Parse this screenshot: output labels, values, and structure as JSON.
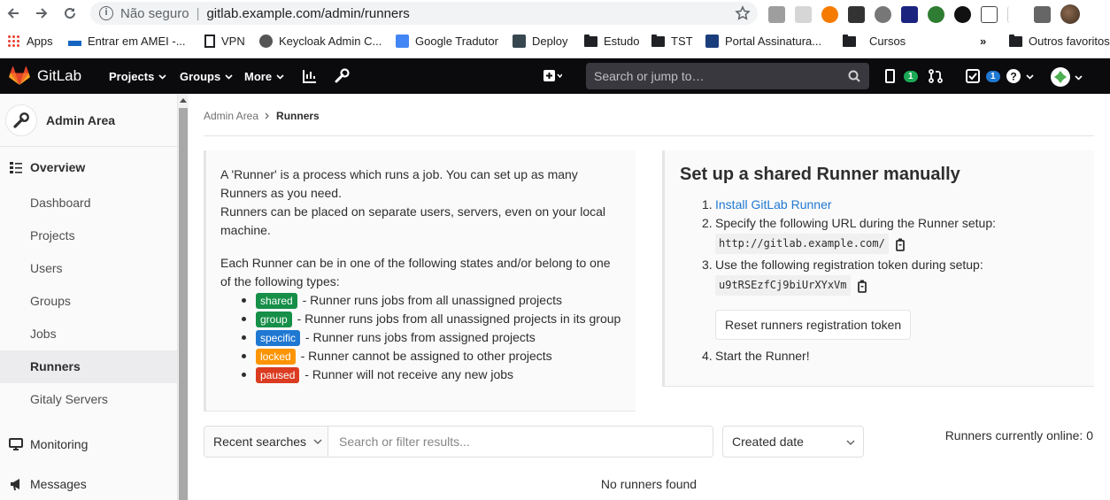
{
  "browser": {
    "insecure_label": "Não seguro",
    "url": "gitlab.example.com/admin/runners",
    "bookmarks": [
      "Apps",
      "Entrar em AMEI -...",
      "VPN",
      "Keycloak Admin C...",
      "Google Tradutor",
      "Deploy",
      "Estudo",
      "TST",
      "Portal Assinatura...",
      "Cursos",
      "»",
      "Outros favoritos"
    ]
  },
  "header": {
    "brand": "GitLab",
    "projects": "Projects",
    "groups": "Groups",
    "more": "More",
    "search_placeholder": "Search or jump to…",
    "issues_count": "1",
    "todos_count": "1"
  },
  "sidebar": {
    "title": "Admin Area",
    "overview": "Overview",
    "items": [
      "Dashboard",
      "Projects",
      "Users",
      "Groups",
      "Jobs",
      "Runners",
      "Gitaly Servers"
    ],
    "monitoring": "Monitoring",
    "messages": "Messages"
  },
  "breadcrumb": {
    "parent": "Admin Area",
    "current": "Runners"
  },
  "info": {
    "p1_line1": "A 'Runner' is a process which runs a job. You can set up as many",
    "p1_line2": "Runners as you need.",
    "p1_line3": "Runners can be placed on separate users, servers, even on your local",
    "p1_line4": "machine.",
    "p2_line1": "Each Runner can be in one of the following states and/or belong to one",
    "p2_line2": "of the following types:",
    "types": [
      {
        "tag": "shared",
        "desc": "- Runner runs jobs from all unassigned projects",
        "color": "#168f48"
      },
      {
        "tag": "group",
        "desc": "- Runner runs jobs from all unassigned projects in its group",
        "color": "#168f48"
      },
      {
        "tag": "specific",
        "desc": "- Runner runs jobs from assigned projects",
        "color": "#1f78d1"
      },
      {
        "tag": "locked",
        "desc": "- Runner cannot be assigned to other projects",
        "color": "#fc9403"
      },
      {
        "tag": "paused",
        "desc": "- Runner will not receive any new jobs",
        "color": "#db3b21"
      }
    ]
  },
  "setup": {
    "title": "Set up a shared Runner manually",
    "step1_link": "Install GitLab Runner",
    "step2": "Specify the following URL during the Runner setup:",
    "url_code": "http://gitlab.example.com/",
    "step3": "Use the following registration token during setup:",
    "token_code": "u9tRSEzfCj9biUrXYxVm",
    "reset_button": "Reset runners registration token",
    "step4": "Start the Runner!"
  },
  "filter": {
    "recent_searches": "Recent searches",
    "placeholder": "Search or filter results...",
    "sort": "Created date"
  },
  "online_text": "Runners currently online: 0",
  "empty_text": "No runners found"
}
